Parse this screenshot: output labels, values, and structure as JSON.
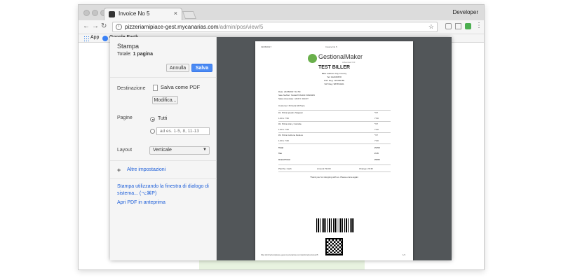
{
  "browser": {
    "tab_title": "Invoice No 5",
    "tab_close": "×",
    "profile_name": "Developer",
    "url_host": "pizzeriamipiace-gest.mycanarias.com",
    "url_path": "/admin/pos/view/5",
    "bookmarks": [
      {
        "label": "App"
      },
      {
        "label": "Google Earth"
      }
    ]
  },
  "print_dialog": {
    "title": "Stampa",
    "total_label": "Totale:",
    "total_value": "1 pagina",
    "cancel_label": "Annulla",
    "save_label": "Salva",
    "destination": {
      "label": "Destinazione",
      "value": "Salva come PDF",
      "modify_label": "Modifica..."
    },
    "pages": {
      "label": "Pagine",
      "all_label": "Tutti",
      "custom_placeholder": "ad es. 1-5, 8, 11-13"
    },
    "layout": {
      "label": "Layout",
      "value": "Verticale"
    },
    "more_settings_label": "Altre impostazioni",
    "system_dialog_link": "Stampa utilizzando la finestra di dialogo di",
    "system_dialog_link_2": "sistema... (⌥⌘P)",
    "open_pdf_link": "Apri PDF in anteprima"
  },
  "receipt": {
    "header_date": "19/08/2017",
    "header_title": "Invoice No 5",
    "logo_name": "GestionalMaker",
    "logo_sub": "Advanced 3.0",
    "title": "TEST BILLER",
    "biller_lines": [
      "Biller address City Country",
      "Tel: 012345678",
      "GST Reg: 123456789",
      "VAT Reg: 987654321"
    ],
    "info_lines": [
      "Date: 24/08/2017 12:59",
      "Sale No/Ref: SALE/POS/2017/08/0005",
      "Sales Associate: JACKY JACKY"
    ],
    "customer": "Customer: Pizzeria Mi Piace",
    "items": [
      {
        "name": "#1.  Pizza Quattro Stagioni",
        "tax": "*VT",
        "qty": "1.00 x 7.50",
        "amount": "7.50"
      },
      {
        "name": "#2.  Pizza Atún y Cebolla",
        "tax": "*VT",
        "qty": "1.00 x 7.00",
        "amount": "7.00"
      },
      {
        "name": "#3.  Pizza Calzone Relleno",
        "tax": "*VT",
        "qty": "1.00 x 7.00",
        "amount": "7.00"
      }
    ],
    "total_label": "Total",
    "total_value": "21.50",
    "tax_label": "Tax",
    "tax_value": "2.15",
    "grand_total_label": "Grand Total",
    "grand_total_value": "23.65",
    "paid_by": "Paid by: Cash",
    "amount_paid": "Amount: 50.00",
    "change": "Change: 26.35",
    "thanks": "Thank you for shopping with us. Please come again",
    "footer_url": "http://pizzeriamipiace-gest.mycanarias.com/admin/pos/view/5",
    "footer_page": "1/1"
  },
  "colors": {
    "save_button": "#4a8af4",
    "link": "#1a5cd8",
    "preview_bg": "#525659",
    "logo_green": "#6ab04c"
  }
}
